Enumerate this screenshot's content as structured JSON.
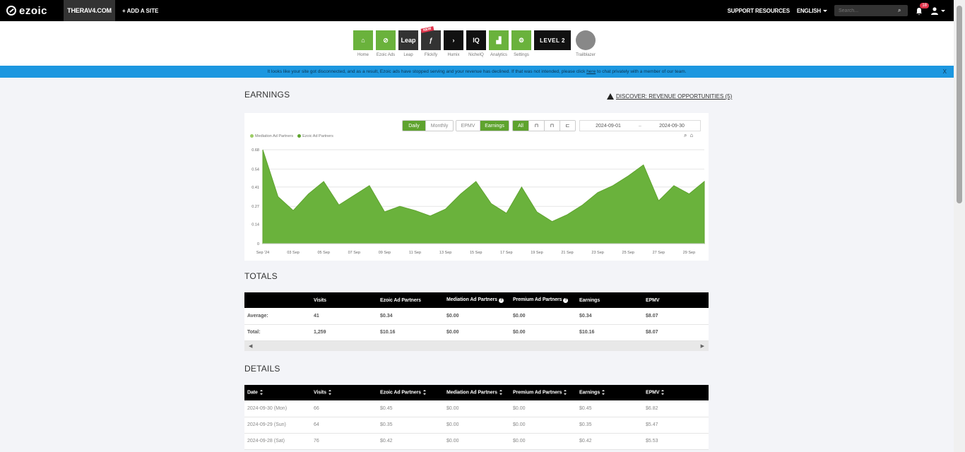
{
  "nav": {
    "logo": "ezoic",
    "site": "THERAV4.COM",
    "add_site": "+ ADD A SITE",
    "support": "SUPPORT RESOURCES",
    "language": "ENGLISH",
    "search_placeholder": "Search...",
    "notifications": "18"
  },
  "apps": [
    {
      "label": "Home",
      "text": "⌂",
      "style": "green"
    },
    {
      "label": "Ezoic Ads",
      "text": "⊘",
      "style": "green"
    },
    {
      "label": "Leap",
      "text": "Leap",
      "style": "dark"
    },
    {
      "label": "Flickify",
      "text": "ƒ",
      "style": "dark",
      "tag": "NEW"
    },
    {
      "label": "Humix",
      "text": "›",
      "style": "black"
    },
    {
      "label": "NicheIQ",
      "text": "IQ",
      "style": "black"
    },
    {
      "label": "Analytics",
      "text": "▟",
      "style": "green"
    },
    {
      "label": "Settings",
      "text": "⚙",
      "style": "green"
    },
    {
      "label": "",
      "text": "LEVEL 2",
      "style": "level"
    },
    {
      "label": "Trailblazer",
      "text": "",
      "style": "trail"
    }
  ],
  "alert": {
    "text_before": "It looks like your site got disconnected, and as a result, Ezoic ads have stopped serving and your revenue has declined. If that was not intended, please click ",
    "link": "here",
    "text_after": " to chat privately with a member of our team.",
    "close": "X"
  },
  "earnings": {
    "title": "EARNINGS",
    "discover": "DISCOVER: REVENUE OPPORTUNITIES (5)",
    "period_buttons": [
      "Daily",
      "Monthly"
    ],
    "metric_buttons": [
      "EPMV",
      "Earnings"
    ],
    "filter_buttons": [
      "All",
      "⊓",
      "⊓",
      "⊏"
    ],
    "date_start": "2024-09-01",
    "date_sep": "–",
    "date_end": "2024-09-30",
    "legend": [
      "Mediation Ad Partners",
      "Ezoic Ad Partners"
    ]
  },
  "chart_data": {
    "type": "area",
    "series": [
      {
        "name": "Ezoic Ad Partners",
        "color": "#6ab23c",
        "values": [
          0.68,
          0.34,
          0.24,
          0.36,
          0.45,
          0.28,
          0.35,
          0.42,
          0.23,
          0.27,
          0.24,
          0.2,
          0.25,
          0.36,
          0.45,
          0.29,
          0.22,
          0.41,
          0.23,
          0.16,
          0.21,
          0.28,
          0.37,
          0.42,
          0.49,
          0.57,
          0.31,
          0.42,
          0.36,
          0.45
        ]
      },
      {
        "name": "Mediation Ad Partners",
        "color": "#9ccc65",
        "values": [
          0,
          0,
          0,
          0,
          0,
          0,
          0,
          0,
          0,
          0,
          0,
          0,
          0,
          0,
          0,
          0,
          0,
          0,
          0,
          0,
          0,
          0,
          0,
          0,
          0,
          0,
          0,
          0,
          0,
          0
        ]
      }
    ],
    "x_labels": [
      "Sep '24",
      "03 Sep",
      "05 Sep",
      "07 Sep",
      "09 Sep",
      "11 Sep",
      "13 Sep",
      "15 Sep",
      "17 Sep",
      "19 Sep",
      "21 Sep",
      "23 Sep",
      "25 Sep",
      "27 Sep",
      "29 Sep"
    ],
    "y_ticks": [
      "0",
      "0.14",
      "0.27",
      "0.41",
      "0.54",
      "0.68"
    ],
    "ylim": [
      0,
      0.68
    ],
    "grid": true,
    "legend": "top-left"
  },
  "totals": {
    "title": "TOTALS",
    "columns": [
      "",
      "Visits",
      "Ezoic Ad Partners",
      "Mediation Ad Partners",
      "Premium Ad Partners",
      "Earnings",
      "EPMV"
    ],
    "rows": [
      [
        "Average:",
        "41",
        "$0.34",
        "$0.00",
        "$0.00",
        "$0.34",
        "$8.07"
      ],
      [
        "Total:",
        "1,259",
        "$10.16",
        "$0.00",
        "$0.00",
        "$10.16",
        "$8.07"
      ]
    ],
    "scroll_left": "◀",
    "scroll_right": "▶"
  },
  "details": {
    "title": "DETAILS",
    "columns": [
      "Date",
      "Visits",
      "Ezoic Ad Partners",
      "Mediation Ad Partners",
      "Premium Ad Partners",
      "Earnings",
      "EPMV"
    ],
    "rows": [
      [
        "2024-09-30 (Mon)",
        "66",
        "$0.45",
        "$0.00",
        "$0.00",
        "$0.45",
        "$6.82"
      ],
      [
        "2024-09-29 (Sun)",
        "64",
        "$0.35",
        "$0.00",
        "$0.00",
        "$0.35",
        "$5.47"
      ],
      [
        "2024-09-28 (Sat)",
        "76",
        "$0.42",
        "$0.00",
        "$0.00",
        "$0.42",
        "$5.53"
      ]
    ]
  }
}
